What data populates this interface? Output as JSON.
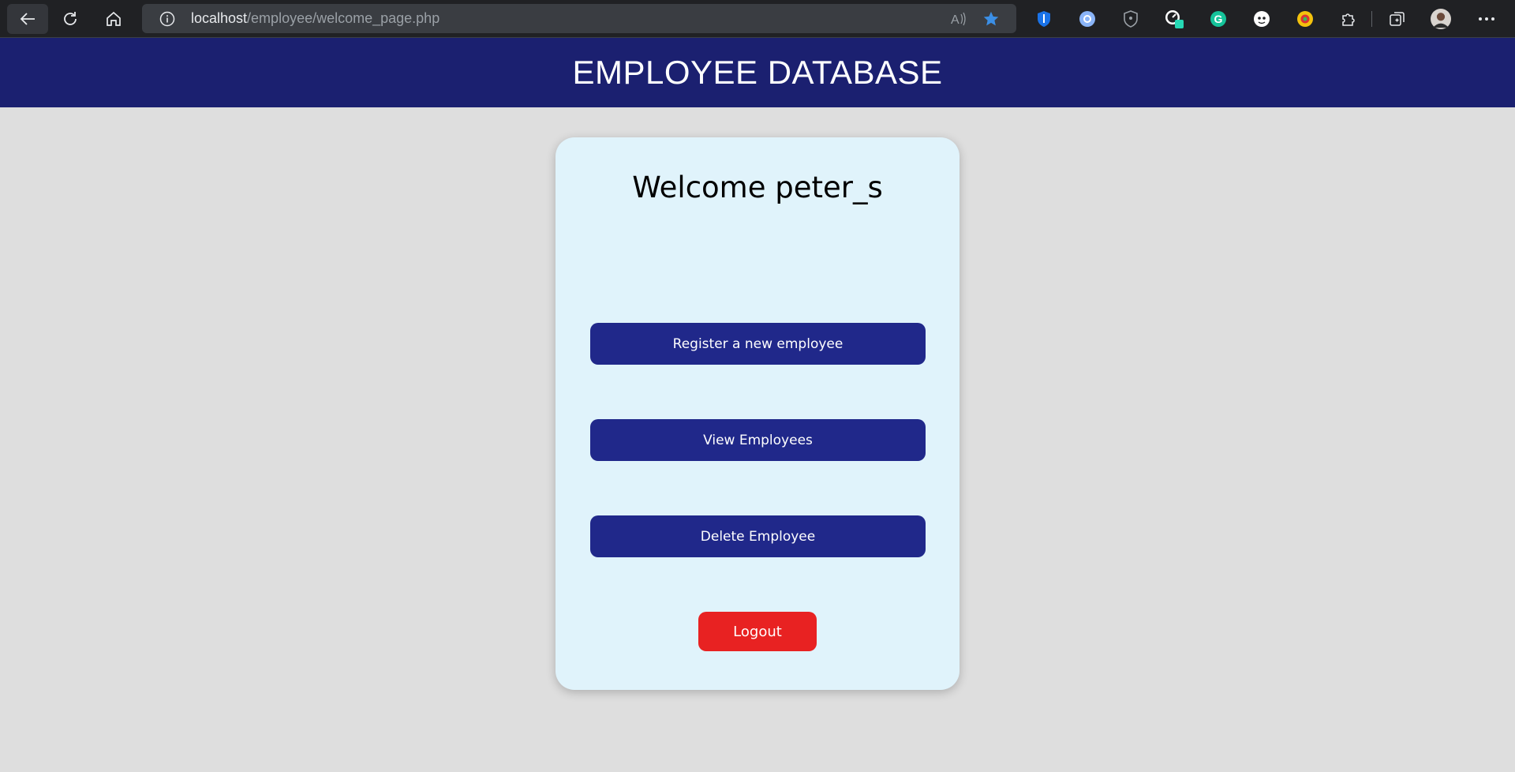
{
  "browser": {
    "url_host": "localhost",
    "url_path": "/employee/welcome_page.php",
    "icons": {
      "back": "back-arrow-icon",
      "refresh": "refresh-icon",
      "home": "home-icon",
      "info": "info-icon",
      "read_aloud": "read-aloud-icon",
      "favorite": "star-icon",
      "more": "more-icon"
    }
  },
  "header": {
    "title": "EMPLOYEE DATABASE"
  },
  "card": {
    "welcome": "Welcome peter_s",
    "buttons": {
      "register": "Register a new employee",
      "view": "View Employees",
      "delete": "Delete Employee",
      "logout": "Logout"
    }
  },
  "colors": {
    "header_bg": "#1b2070",
    "button_bg": "#20288a",
    "logout_bg": "#e82222",
    "card_bg": "#e0f3fb",
    "page_bg": "#dedede"
  }
}
